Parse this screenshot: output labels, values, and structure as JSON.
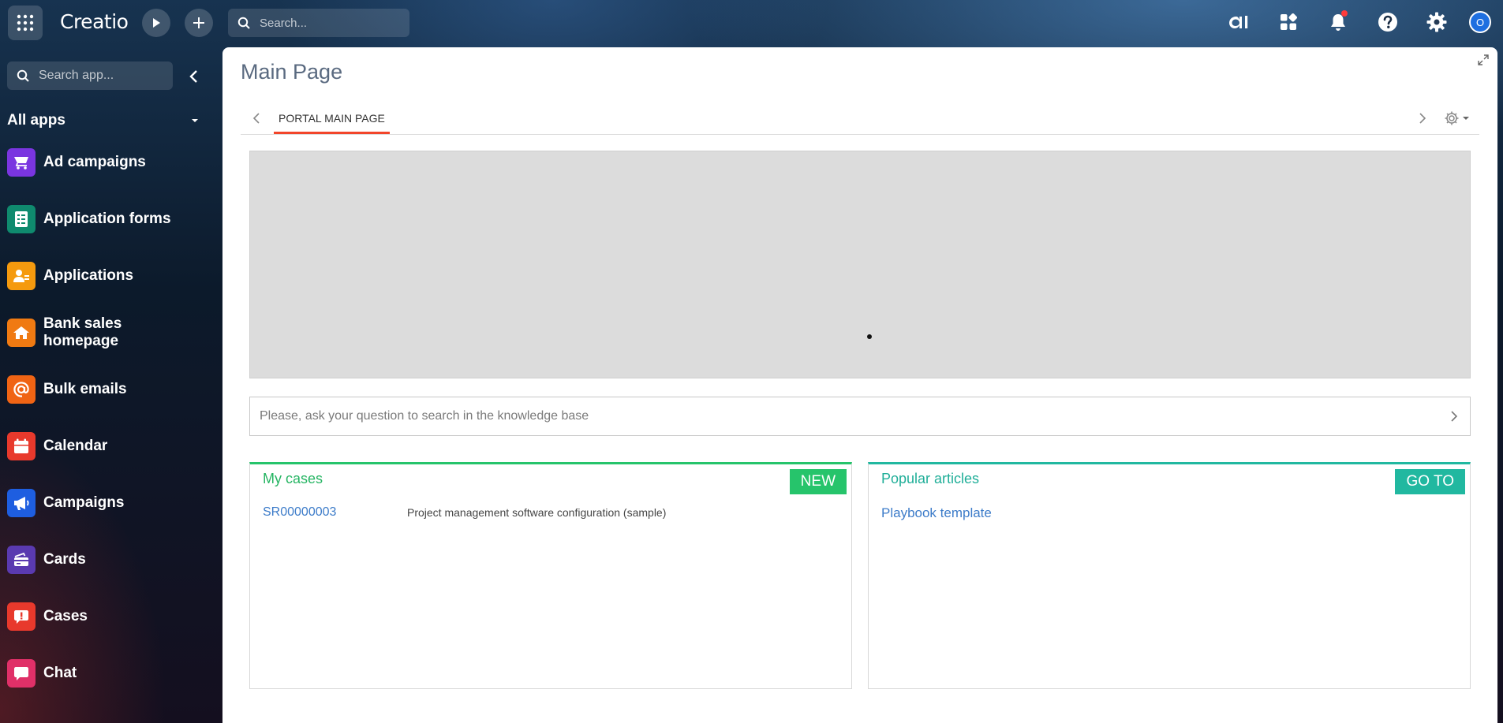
{
  "topbar": {
    "logo": "Creatio",
    "search_placeholder": "Search...",
    "avatar_initial": "O",
    "notification_color": "#ff3b3b"
  },
  "sidebar": {
    "search_placeholder": "Search app...",
    "all_apps_label": "All apps",
    "items": [
      {
        "label": "Ad campaigns",
        "icon": "megaphone-cart-icon",
        "color": "#7a35e0"
      },
      {
        "label": "Application forms",
        "icon": "form-icon",
        "color": "#0f8a6e"
      },
      {
        "label": "Applications",
        "icon": "person-card-icon",
        "color": "#f59a0e"
      },
      {
        "label": "Bank sales homepage",
        "icon": "home-icon",
        "color": "#f07a12"
      },
      {
        "label": "Bulk emails",
        "icon": "at-icon",
        "color": "#f06414"
      },
      {
        "label": "Calendar",
        "icon": "calendar-icon",
        "color": "#e8392c"
      },
      {
        "label": "Campaigns",
        "icon": "megaphone-icon",
        "color": "#1e5ee0"
      },
      {
        "label": "Cards",
        "icon": "card-icon",
        "color": "#5a3ab0"
      },
      {
        "label": "Cases",
        "icon": "exclamation-icon",
        "color": "#e8392c"
      },
      {
        "label": "Chat",
        "icon": "chat-icon",
        "color": "#e03068"
      }
    ]
  },
  "main": {
    "title": "Main Page",
    "tab_label": "PORTAL MAIN PAGE",
    "kb_search_placeholder": "Please, ask your question to search in the knowledge base",
    "cases_card": {
      "title": "My cases",
      "button": "NEW",
      "rows": [
        {
          "id": "SR00000003",
          "subject": "Project management software configuration (sample)"
        }
      ]
    },
    "articles_card": {
      "title": "Popular articles",
      "button": "GO TO",
      "items": [
        "Playbook template"
      ]
    }
  }
}
